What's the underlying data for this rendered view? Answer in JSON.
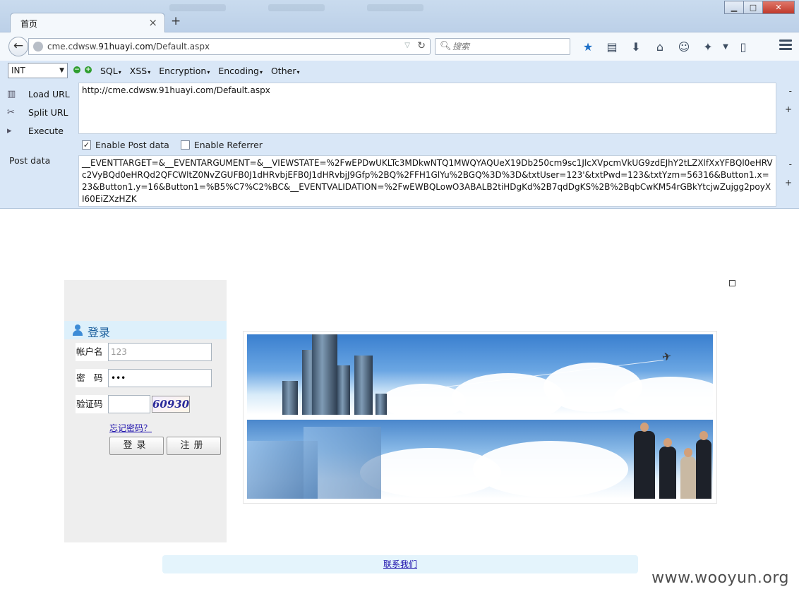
{
  "browser": {
    "tab_title": "首页",
    "tab_close": "×",
    "new_tab": "+",
    "window_controls": {
      "minimize": "▁",
      "maximize": "□",
      "close": "✕"
    },
    "url_prefix": "cme.cdwsw.",
    "url_domain": "91huayi.com",
    "url_path": "/Default.aspx",
    "search_placeholder": "搜索",
    "accent_color": "#1c6fc7"
  },
  "hackbar": {
    "mode": "INT",
    "menus": [
      "SQL",
      "XSS",
      "Encryption",
      "Encoding",
      "Other"
    ],
    "actions": [
      {
        "label": "Load URL",
        "icon": "load-url-icon"
      },
      {
        "label": "Split URL",
        "icon": "scissors-icon"
      },
      {
        "label": "Execute",
        "icon": "play-icon"
      }
    ],
    "url_value": "http://cme.cdwsw.91huayi.com/Default.aspx",
    "enable_post": {
      "label": "Enable Post data",
      "checked": true
    },
    "enable_referrer": {
      "label": "Enable Referrer",
      "checked": false
    },
    "post_label": "Post data",
    "post_value": "__EVENTTARGET=&__EVENTARGUMENT=&__VIEWSTATE=%2FwEPDwUKLTc3MDkwNTQ1MWQYAQUeX19Db250cm9sc1JlcXVpcmVkUG9zdEJhY2tLZXlfXxYFBQl0eHRVc2VyBQd0eHRQd2QFCWltZ0NvZGUFB0J1dHRvbjEFB0J1dHRvbjJ9Gfp%2BQ%2FFH1GlYu%2BGQ%3D%3D&txtUser=123'&txtPwd=123&txtYzm=56316&Button1.x=23&Button1.y=16&Button1=%B5%C7%C2%BC&__EVENTVALIDATION=%2FwEWBQLowO3ABALB2tiHDgKd%2B7qdDgKS%2B%2BqbCwKM54rGBkYtcjwZujgg2poyXI60EiZXzHZK",
    "side_minus": "-",
    "side_plus": "+"
  },
  "login": {
    "title": "登录",
    "user_label": "帐户名",
    "user_value": "123",
    "pwd_label": "密　码",
    "pwd_value": "123",
    "code_label": "验证码",
    "code_value": "",
    "captcha": "60930",
    "forgot": "忘记密码？",
    "login_button": "登录",
    "register_button": "注册"
  },
  "footer": {
    "contact": "联系我们"
  },
  "watermark": "www.wooyun.org"
}
